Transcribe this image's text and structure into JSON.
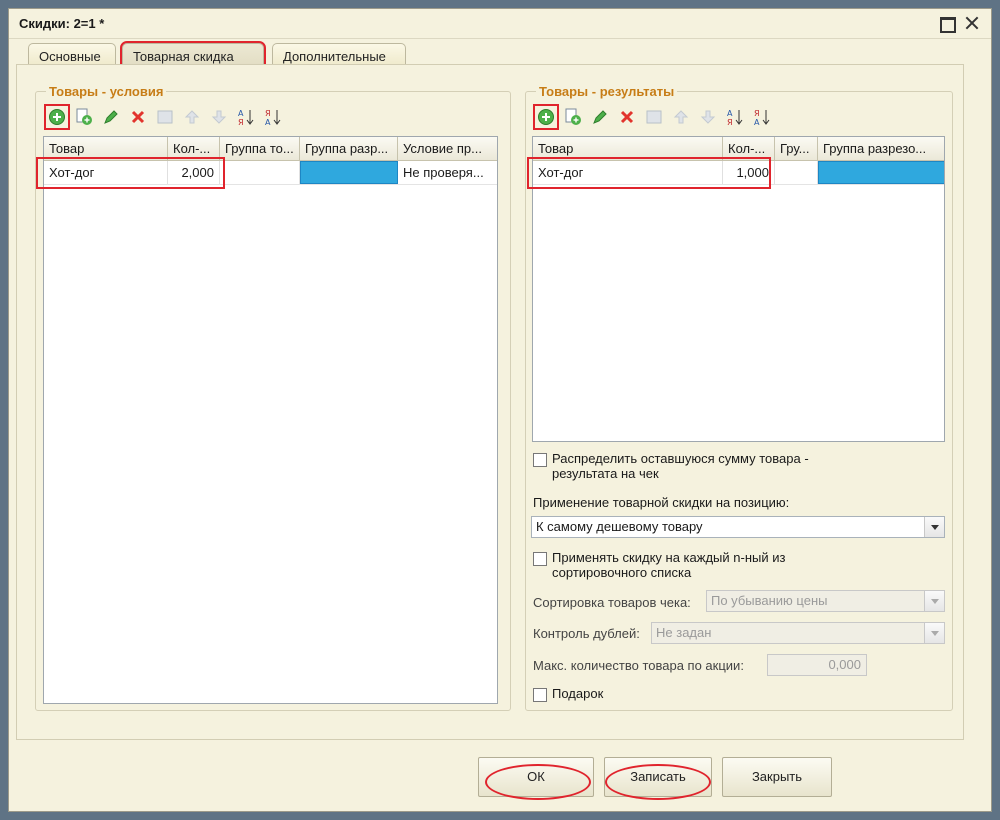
{
  "window": {
    "title": "Скидки: 2=1 *"
  },
  "tabs": [
    {
      "label": "Основные"
    },
    {
      "label": "Товарная скидка"
    },
    {
      "label": "Дополнительные"
    }
  ],
  "conditions": {
    "title": "Товары - условия",
    "columns": [
      "Товар",
      "Кол-...",
      "Группа то...",
      "Группа разр...",
      "Условие пр..."
    ],
    "rows": [
      {
        "item": "Хот-дог",
        "qty": "2,000",
        "group": "",
        "cut_group": "",
        "condition": "Не проверя..."
      }
    ]
  },
  "results": {
    "title": "Товары - результаты",
    "columns": [
      "Товар",
      "Кол-...",
      "Гру...",
      "Группа разрезо..."
    ],
    "rows": [
      {
        "item": "Хот-дог",
        "qty": "1,000",
        "group": "",
        "cut_group": ""
      }
    ]
  },
  "toolbar_icons": [
    "add-icon",
    "copy-icon",
    "edit-icon",
    "delete-icon",
    "move-icon",
    "move-up-icon",
    "move-down-icon",
    "sort-asc-icon",
    "sort-desc-icon"
  ],
  "options": {
    "distribute_label": "Распределить оставшуюся сумму товара - результата на чек",
    "distribute_checked": false,
    "apply_label": "Применение товарной скидки на позицию:",
    "apply_value": "К самому дешевому товару",
    "every_nth_label": "Применять скидку на каждый n-ный из сортировочного списка",
    "every_nth_checked": false,
    "sort_label": "Сортировка товаров чека:",
    "sort_value": "По убыванию цены",
    "dup_label": "Контроль дублей:",
    "dup_value": "Не задан",
    "max_qty_label": "Макс. количество товара по акции:",
    "max_qty_value": "0,000",
    "gift_label": "Подарок",
    "gift_checked": false
  },
  "buttons": {
    "ok": "ОК",
    "save": "Записать",
    "close": "Закрыть"
  },
  "colors": {
    "highlight": "#e0242d",
    "group_title": "#c77d17",
    "selected_cell": "#2fa8de"
  }
}
